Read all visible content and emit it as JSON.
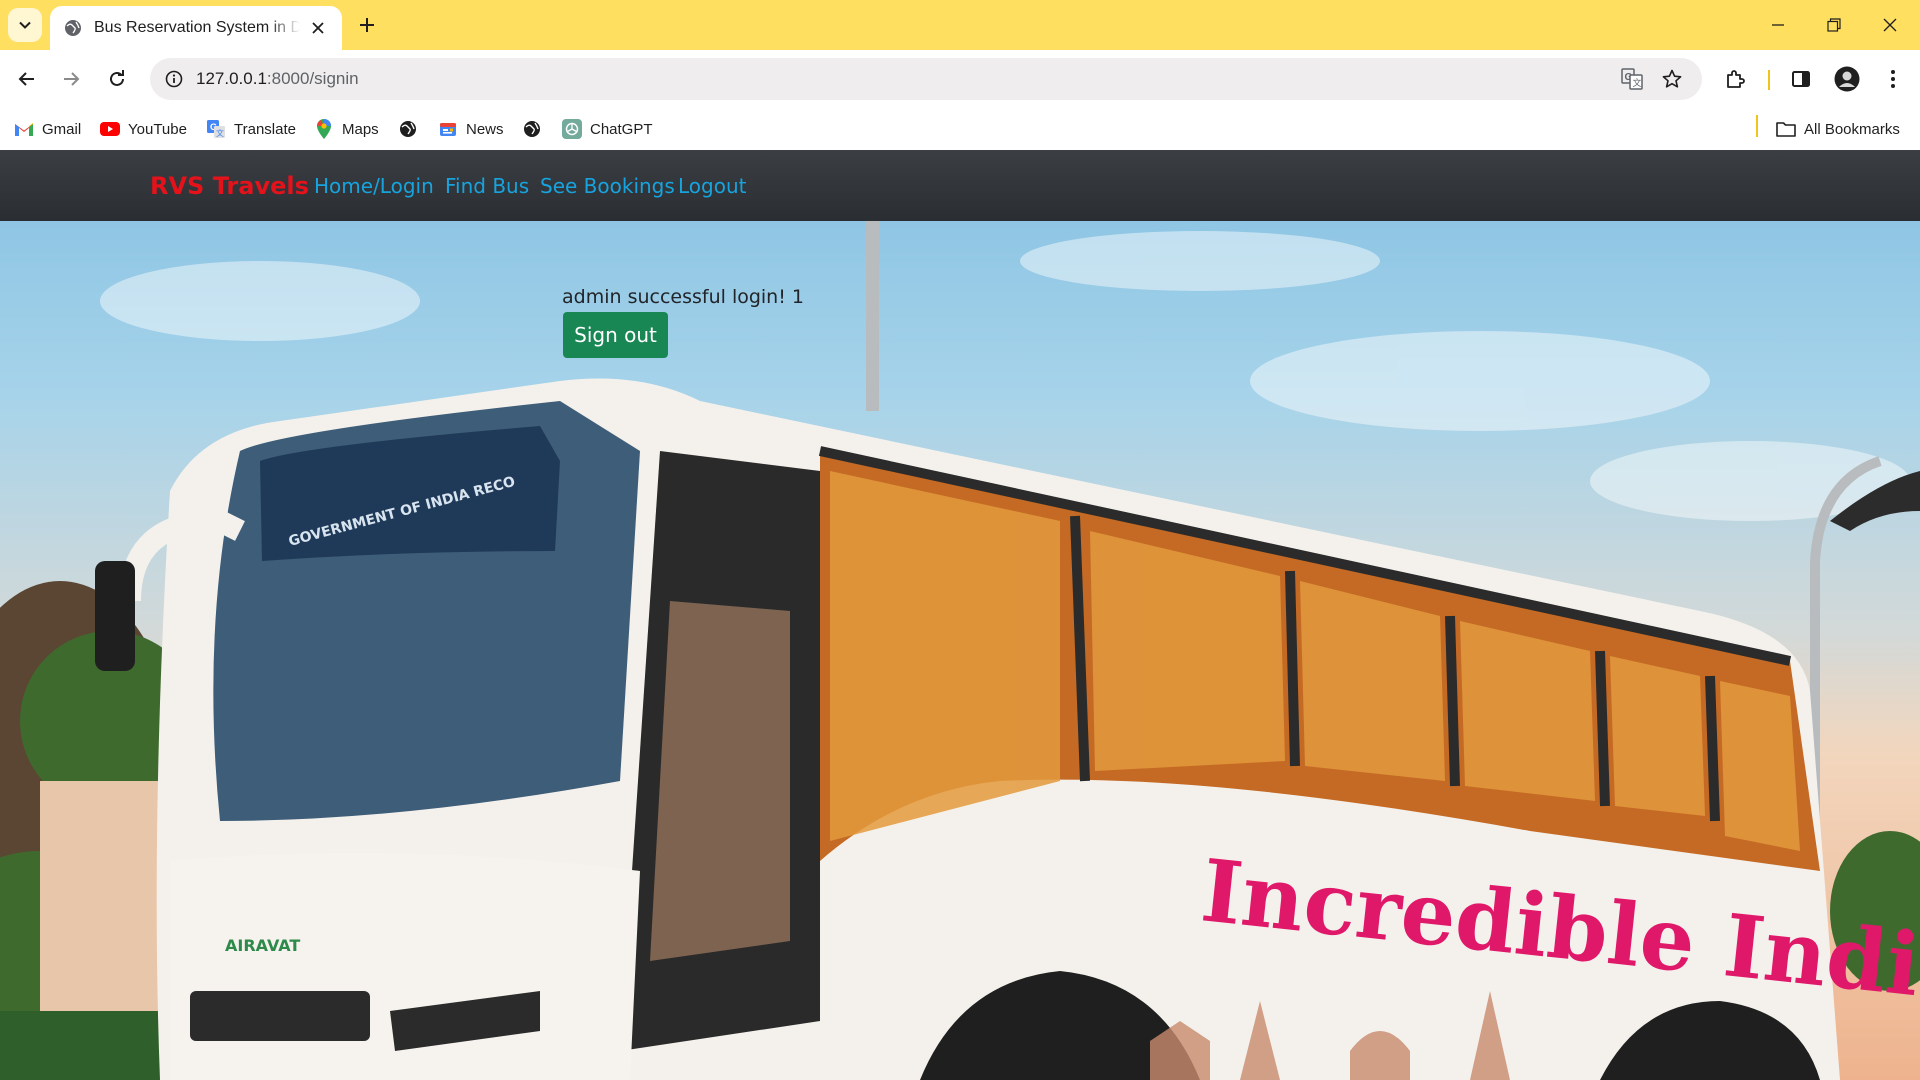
{
  "browser": {
    "tab": {
      "title": "Bus Reservation System in Django"
    },
    "url": {
      "host": "127.0.0.1",
      "path": ":8000/signin"
    },
    "bookmarks": [
      {
        "label": "Gmail",
        "icon": "gmail-icon"
      },
      {
        "label": "YouTube",
        "icon": "youtube-icon"
      },
      {
        "label": "Translate",
        "icon": "translate-icon"
      },
      {
        "label": "Maps",
        "icon": "maps-icon"
      },
      {
        "label": "",
        "icon": "globe-icon"
      },
      {
        "label": "News",
        "icon": "news-icon"
      },
      {
        "label": "",
        "icon": "globe-icon"
      },
      {
        "label": "ChatGPT",
        "icon": "chatgpt-icon"
      }
    ],
    "all_bookmarks": "All Bookmarks",
    "theme_color": "#ffdf5f"
  },
  "site": {
    "brand": "RVS Travels",
    "brand_color": "#e3121b",
    "nav": [
      {
        "label": "Home/Login"
      },
      {
        "label": "Find Bus"
      },
      {
        "label": "See Bookings"
      },
      {
        "label": "Logout"
      }
    ],
    "link_color": "#17a4de"
  },
  "main": {
    "message": "admin successful login! 1",
    "signout_label": "Sign out",
    "signout_color": "#198754"
  },
  "hero_image": {
    "text_on_bus": "Incredible India",
    "text_on_windshield": "GOVERNMENT OF INDIA RECO",
    "text_on_grille": "AIRAVAT"
  }
}
